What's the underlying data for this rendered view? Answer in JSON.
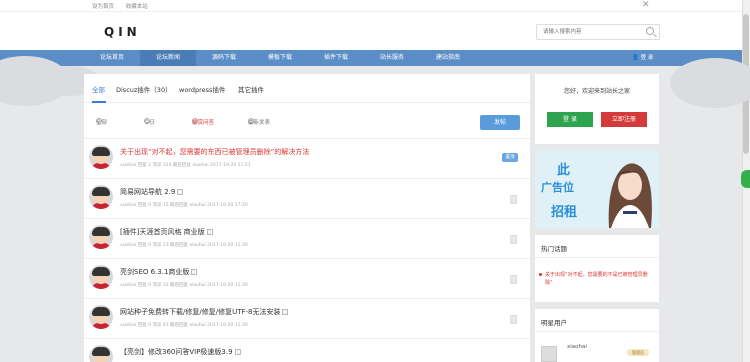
{
  "topbar": {
    "links": [
      "设为首页",
      "收藏本站"
    ]
  },
  "header": {
    "logo": "QIN",
    "search_placeholder": "请输入搜索内容"
  },
  "nav": {
    "items": [
      "论坛首页",
      "论坛新闻",
      "源码下载",
      "模板下载",
      "插件下载",
      "站长服务",
      "建站指南"
    ],
    "user": "登 录"
  },
  "tabs": [
    "全部",
    "Discuz插件（30）",
    "wordpress插件",
    "其它插件"
  ],
  "filters": {
    "all": "全部",
    "today": "今日",
    "bounty": "悬赏问答",
    "latest": "最新发表"
  },
  "post_button": "发帖",
  "rows": [
    {
      "title": "关于出现“对不起，您需要的东西已被管理员删除”的解决方法",
      "meta": "xiaohai  回复 2  浏览 314  最后回复 xiaohai 2017-10-20 11:21",
      "tag": "置顶",
      "red": true
    },
    {
      "title": "简易网站导航 2.9",
      "meta": "xiaohai  回复 0  浏览 15  最后回复 xiaohai 2017-10-20 17:20",
      "tag": "",
      "red": false
    },
    {
      "title": "[插件]天涯首页风格 商业版",
      "meta": "xiaohai  回复 0  浏览 23  最后回复 xiaohai 2017-10-20 11:30",
      "tag": "",
      "red": false
    },
    {
      "title": "亮剑SEO 6.3.1商业版",
      "meta": "xiaohai  回复 0  浏览 31  最后回复 xiaohai 2017-10-20 11:30",
      "tag": "",
      "red": false
    },
    {
      "title": "网站种子免费转下载/修复/修复/修复UTF-8无法安装",
      "meta": "xiaohai  回复 0  浏览 41  最后回复 xiaohai 2017-10-20 11:30",
      "tag": "",
      "red": false
    },
    {
      "title": "【亮剑】修改360问答VIP极速版3.9",
      "meta": "",
      "tag": "",
      "red": false
    }
  ],
  "side_welcome": {
    "text": "您好，欢迎来到站长之家",
    "login": "登 录",
    "register": "立即注册"
  },
  "ad": {
    "line1": "此",
    "line2": "广告位",
    "line3": "招租"
  },
  "hot": {
    "title": "热门话题",
    "item": "关于出现“对不起，您需要的不是已被管理员删除”"
  },
  "stars": {
    "title": "明星用户",
    "name": "xiaohai",
    "badge": "管理员"
  }
}
